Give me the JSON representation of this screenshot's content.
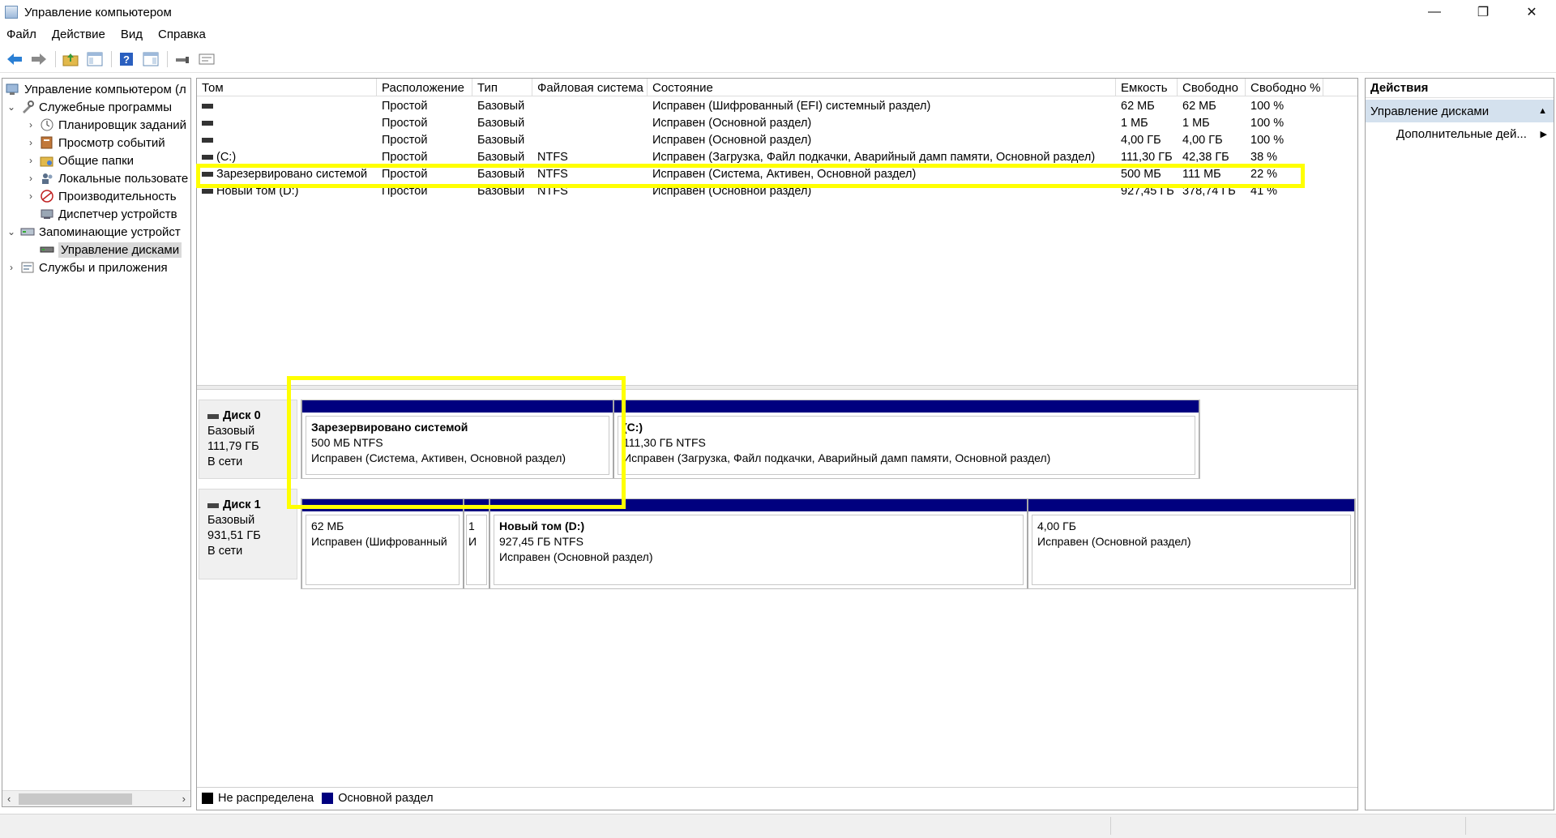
{
  "window": {
    "title": "Управление компьютером",
    "minimize": "—",
    "restore": "❐",
    "close": "✕"
  },
  "menu": [
    "Файл",
    "Действие",
    "Вид",
    "Справка"
  ],
  "toolbar": {
    "icons": [
      "back-icon",
      "forward-icon",
      "up-folder-icon",
      "show-tree-icon",
      "help-icon",
      "properties-icon",
      "connect-icon",
      "settings-icon"
    ]
  },
  "tree": {
    "items": [
      {
        "label": "Управление компьютером (л",
        "level": 0,
        "chev": "",
        "icon": "computer-management-icon"
      },
      {
        "label": "Служебные программы",
        "level": 1,
        "chev": "⌄",
        "icon": "tools-icon"
      },
      {
        "label": "Планировщик заданий",
        "level": 2,
        "chev": "›",
        "icon": "clock-icon"
      },
      {
        "label": "Просмотр событий",
        "level": 2,
        "chev": "›",
        "icon": "event-viewer-icon"
      },
      {
        "label": "Общие папки",
        "level": 2,
        "chev": "›",
        "icon": "shared-folders-icon"
      },
      {
        "label": "Локальные пользовате",
        "level": 2,
        "chev": "›",
        "icon": "users-icon"
      },
      {
        "label": "Производительность",
        "level": 2,
        "chev": "›",
        "icon": "performance-icon"
      },
      {
        "label": "Диспетчер устройств",
        "level": 2,
        "chev": "",
        "icon": "device-manager-icon"
      },
      {
        "label": "Запоминающие устройст",
        "level": 1,
        "chev": "⌄",
        "icon": "storage-icon"
      },
      {
        "label": "Управление дисками",
        "level": 2,
        "chev": "",
        "icon": "disk-management-icon",
        "selected": true
      },
      {
        "label": "Службы и приложения",
        "level": 1,
        "chev": "›",
        "icon": "services-icon"
      }
    ],
    "scroll_left": "‹",
    "scroll_right": "›"
  },
  "volumes": {
    "columns": [
      "Том",
      "Расположение",
      "Тип",
      "Файловая система",
      "Состояние",
      "Емкость",
      "Свободно",
      "Свободно %"
    ],
    "rows": [
      [
        "",
        "Простой",
        "Базовый",
        "",
        "Исправен (Шифрованный (EFI) системный раздел)",
        "62 МБ",
        "62 МБ",
        "100 %"
      ],
      [
        "",
        "Простой",
        "Базовый",
        "",
        "Исправен (Основной раздел)",
        "1 МБ",
        "1 МБ",
        "100 %"
      ],
      [
        "",
        "Простой",
        "Базовый",
        "",
        "Исправен (Основной раздел)",
        "4,00 ГБ",
        "4,00 ГБ",
        "100 %"
      ],
      [
        "(C:)",
        "Простой",
        "Базовый",
        "NTFS",
        "Исправен (Загрузка, Файл подкачки, Аварийный дамп памяти, Основной раздел)",
        "111,30 ГБ",
        "42,38 ГБ",
        "38 %"
      ],
      [
        "Зарезервировано системой",
        "Простой",
        "Базовый",
        "NTFS",
        "Исправен (Система, Активен, Основной раздел)",
        "500 МБ",
        "111 МБ",
        "22 %"
      ],
      [
        "Новый том (D:)",
        "Простой",
        "Базовый",
        "NTFS",
        "Исправен (Основной раздел)",
        "927,45 ГБ",
        "378,74 ГБ",
        "41 %"
      ]
    ]
  },
  "disks": [
    {
      "name": "Диск 0",
      "type": "Базовый",
      "size": "111,79 ГБ",
      "status": "В сети",
      "partitions": [
        {
          "name": "Зарезервировано системой",
          "size": "500 МБ NTFS",
          "status": "Исправен (Система, Активен, Основной раздел)"
        },
        {
          "name": "(C:)",
          "size": "111,30 ГБ NTFS",
          "status": "Исправен (Загрузка, Файл подкачки, Аварийный дамп памяти, Основной раздел)"
        }
      ]
    },
    {
      "name": "Диск 1",
      "type": "Базовый",
      "size": "931,51 ГБ",
      "status": "В сети",
      "partitions": [
        {
          "name": "",
          "size": "62 МБ",
          "status": "Исправен (Шифрованный"
        },
        {
          "name": "",
          "size": "1",
          "status": "И"
        },
        {
          "name": "Новый том  (D:)",
          "size": "927,45 ГБ NTFS",
          "status": "Исправен (Основной раздел)"
        },
        {
          "name": "",
          "size": "4,00 ГБ",
          "status": "Исправен (Основной раздел)"
        }
      ]
    }
  ],
  "legend": [
    {
      "label": "Не распределена",
      "color": "#000000"
    },
    {
      "label": "Основной раздел",
      "color": "#00007f"
    }
  ],
  "actions": {
    "title": "Действия",
    "section": "Управление дисками",
    "section_caret": "▲",
    "item": "Дополнительные дей...",
    "item_arrow": "▶"
  },
  "colors": {
    "highlight": "#ffff00",
    "partition_bar": "#00007f",
    "actions_section_bg": "#d4e1ee"
  }
}
